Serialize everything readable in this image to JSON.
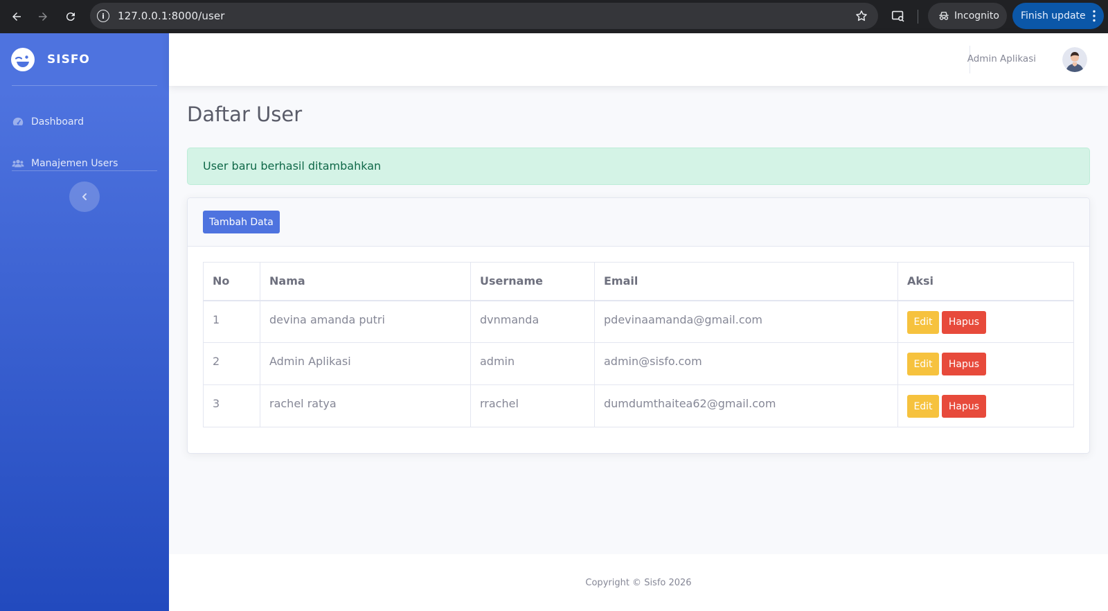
{
  "browser": {
    "url": "127.0.0.1:8000/user",
    "incognito_label": "Incognito",
    "finish_update_label": "Finish update"
  },
  "sidebar": {
    "brand": "SISFO",
    "items": [
      {
        "label": "Dashboard",
        "icon": "tachometer-icon"
      },
      {
        "label": "Manajemen Users",
        "icon": "users-icon"
      }
    ]
  },
  "topbar": {
    "user_name": "Admin Aplikasi"
  },
  "main": {
    "title": "Daftar User",
    "alert": "User baru berhasil ditambahkan",
    "add_button": "Tambah Data",
    "table": {
      "headers": [
        "No",
        "Nama",
        "Username",
        "Email",
        "Aksi"
      ],
      "rows": [
        {
          "no": "1",
          "nama": "devina amanda putri",
          "username": "dvnmanda",
          "email": "pdevinaamanda@gmail.com"
        },
        {
          "no": "2",
          "nama": "Admin Aplikasi",
          "username": "admin",
          "email": "admin@sisfo.com"
        },
        {
          "no": "3",
          "nama": "rachel ratya",
          "username": "rrachel",
          "email": "dumdumthaitea62@gmail.com"
        }
      ],
      "edit_label": "Edit",
      "delete_label": "Hapus"
    }
  },
  "footer": {
    "copyright": "Copyright © Sisfo 2026"
  },
  "colors": {
    "primary": "#4e73df",
    "warning": "#f6c23e",
    "danger": "#e74a3b",
    "success_bg": "#d4f3e6"
  }
}
